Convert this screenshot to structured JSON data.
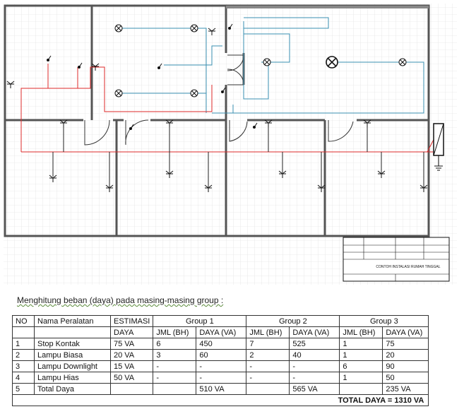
{
  "drawing": {
    "title_block": {
      "title": "CONTOH INSTALASI RUMAH TINGGAL"
    },
    "colors": {
      "grid": "#dcdcdc",
      "wall": "#555555",
      "phase_wire": "#dd2a2a",
      "lamp_wire": "#3a8fb0",
      "symbol": "#111111"
    }
  },
  "caption": "Menghitung beban (daya) pada masing-masing group :",
  "table": {
    "headers": {
      "no": "NO",
      "name": "Nama Peralatan",
      "estimate": "ESTIMASI",
      "estimate_unit": "DAYA",
      "groups": [
        "Group 1",
        "Group 2",
        "Group 3"
      ],
      "qty": "JML (BH)",
      "power": "DAYA (VA)"
    },
    "rows": [
      {
        "no": "1",
        "name": "Stop Kontak",
        "est": "75 VA",
        "g1q": "6",
        "g1p": "450",
        "g2q": "7",
        "g2p": "525",
        "g3q": "1",
        "g3p": "75"
      },
      {
        "no": "2",
        "name": "Lampu Biasa",
        "est": "20 VA",
        "g1q": "3",
        "g1p": "60",
        "g2q": "2",
        "g2p": "40",
        "g3q": "1",
        "g3p": "20"
      },
      {
        "no": "3",
        "name": "Lampu Downlight",
        "est": "15 VA",
        "g1q": "-",
        "g1p": "-",
        "g2q": "-",
        "g2p": "-",
        "g3q": "6",
        "g3p": "90"
      },
      {
        "no": "4",
        "name": "Lampu Hias",
        "est": "50 VA",
        "g1q": "-",
        "g1p": "-",
        "g2q": "-",
        "g2p": "-",
        "g3q": "1",
        "g3p": "50"
      },
      {
        "no": "5",
        "name": "Total Daya",
        "est": "",
        "g1q": "",
        "g1p": "510 VA",
        "g2q": "",
        "g2p": "565 VA",
        "g3q": "",
        "g3p": "235 VA"
      }
    ],
    "total": "TOTAL DAYA = 1310 VA"
  }
}
